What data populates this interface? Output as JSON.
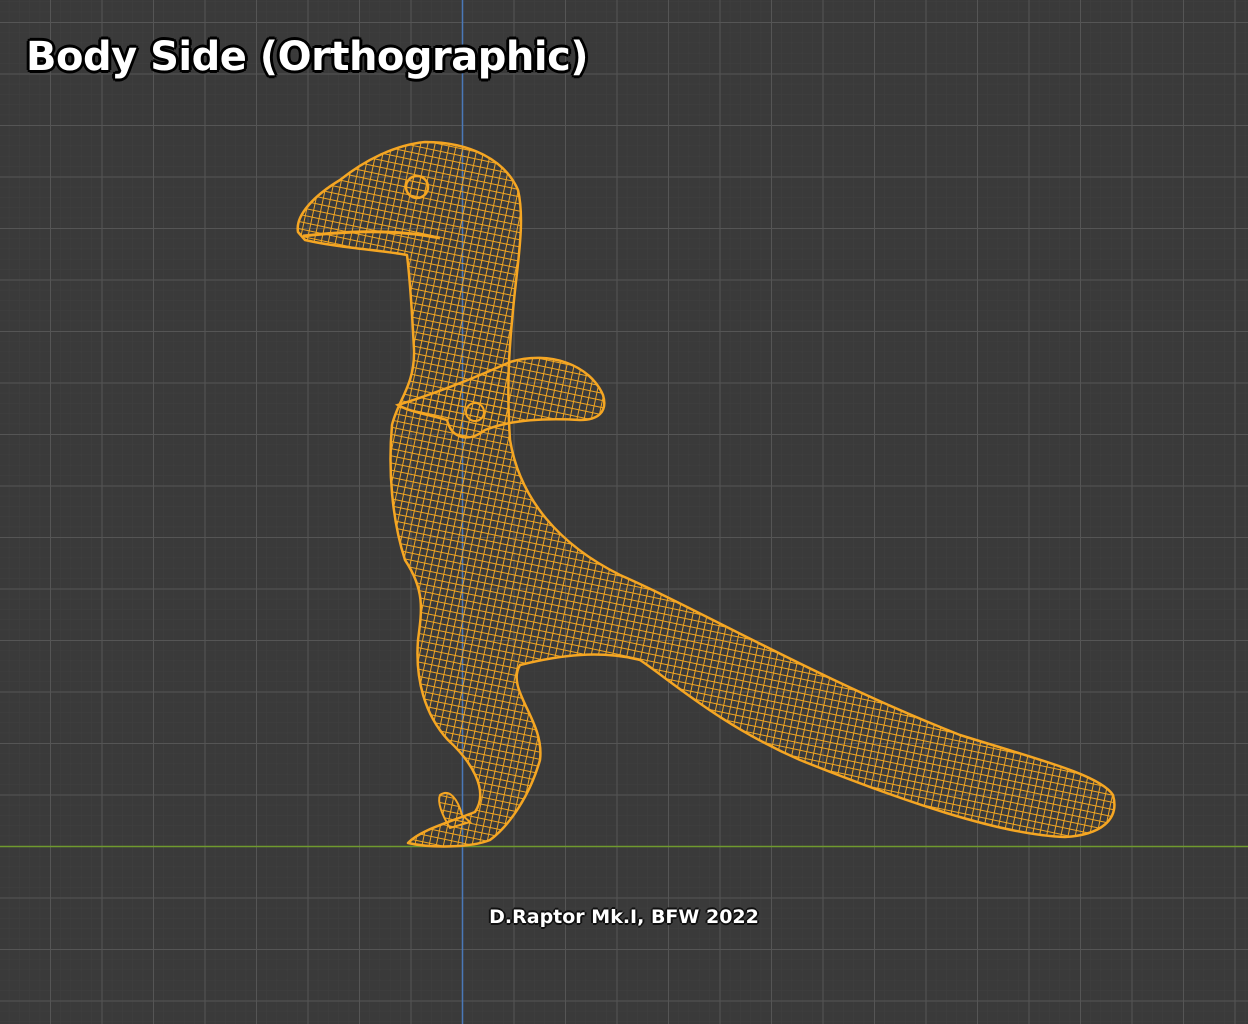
{
  "viewport": {
    "title": "Body Side (Orthographic)",
    "caption": "D.Raptor Mk.I, BFW 2022",
    "colors": {
      "background": "#3a3a3a",
      "grid_major": "#4f4f4f",
      "grid_minor": "#404040",
      "axis_z": "#4a78b8",
      "axis_y": "#6f9a2e",
      "wireframe": "#f0a020"
    }
  }
}
